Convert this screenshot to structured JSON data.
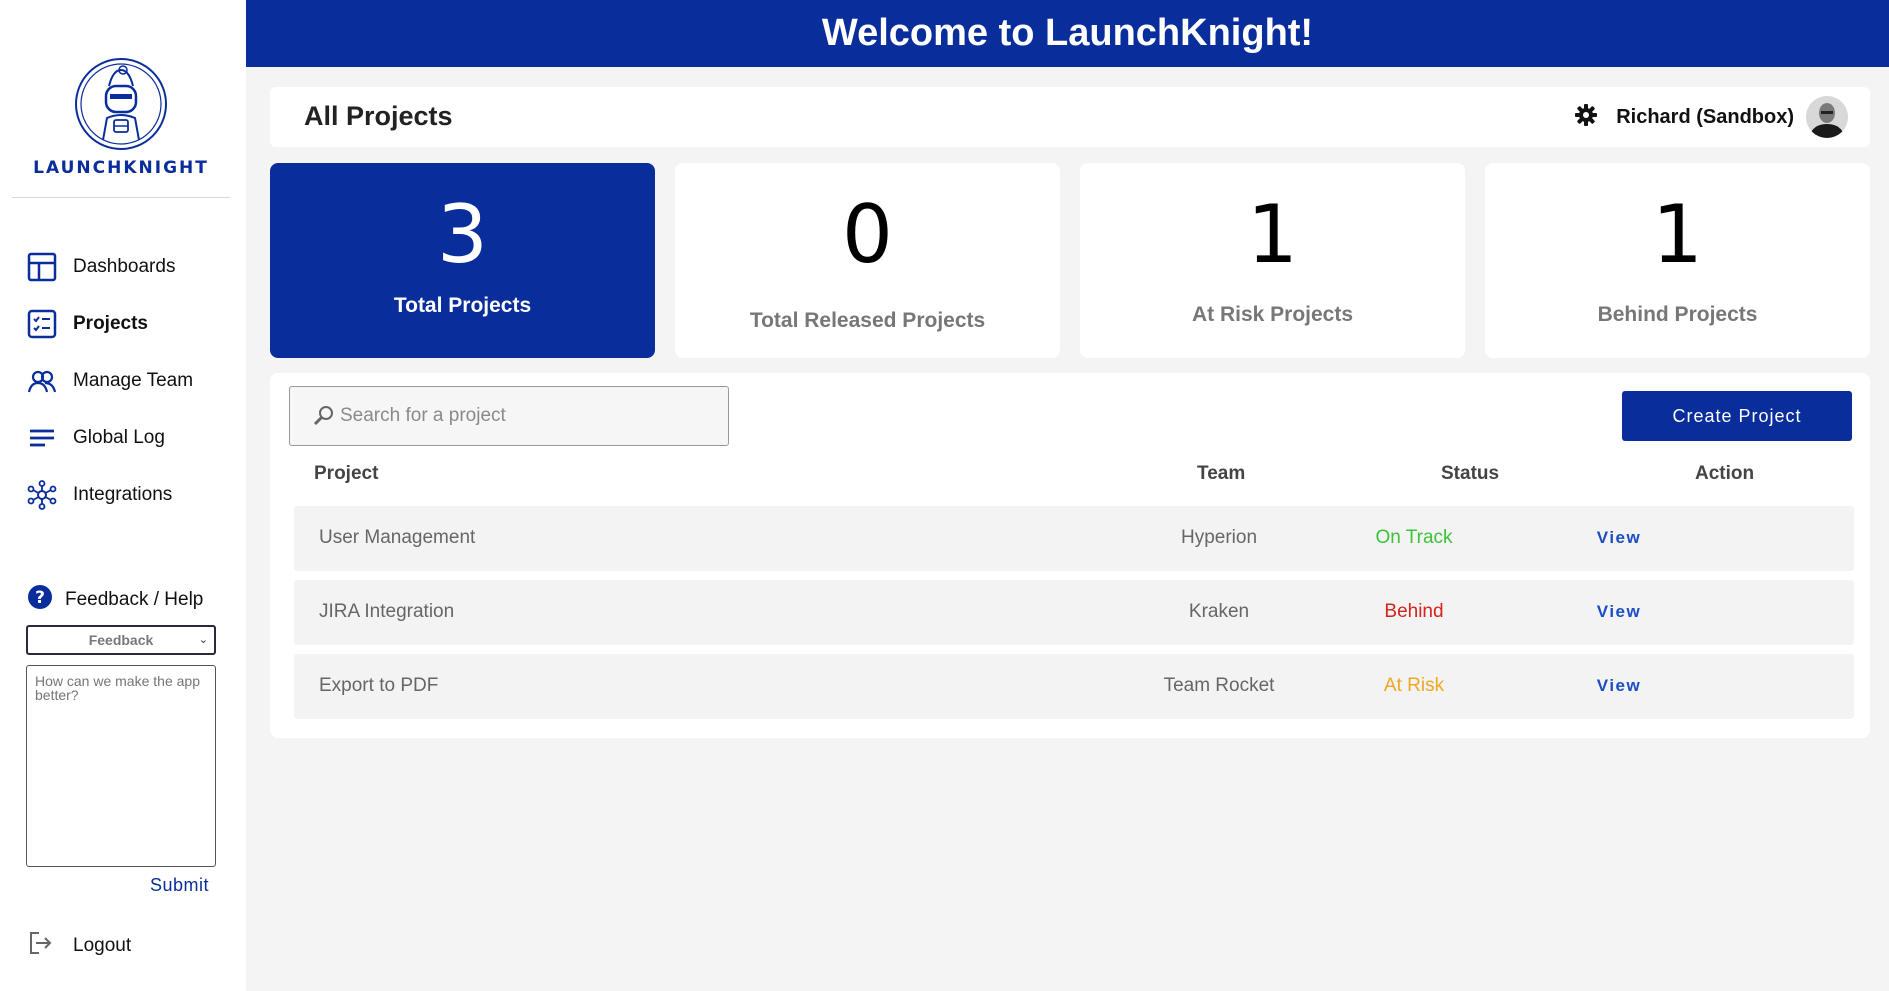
{
  "brand": {
    "logo_text": "LAUNCHKNIGHT",
    "primary_color": "#0a2d9c",
    "banner_title": "Welcome to LaunchKnight!"
  },
  "sidebar": {
    "items": [
      {
        "label": "Dashboards",
        "icon": "dashboard-icon"
      },
      {
        "label": "Projects",
        "icon": "checklist-icon",
        "active": true
      },
      {
        "label": "Manage Team",
        "icon": "team-icon"
      },
      {
        "label": "Global Log",
        "icon": "log-lines-icon"
      },
      {
        "label": "Integrations",
        "icon": "integrations-network-icon"
      }
    ],
    "help_label": "Feedback / Help",
    "feedback_select_value": "Feedback",
    "feedback_placeholder": "How can we make the app better?",
    "submit_label": "Submit",
    "logout_label": "Logout"
  },
  "header": {
    "title": "All Projects",
    "user_name": "Richard (Sandbox)"
  },
  "stats": [
    {
      "value": "3",
      "label": "Total Projects"
    },
    {
      "value": "0",
      "label": "Total Released Projects"
    },
    {
      "value": "1",
      "label": "At Risk Projects"
    },
    {
      "value": "1",
      "label": "Behind Projects"
    }
  ],
  "projects": {
    "search_placeholder": "Search for a project",
    "create_label": "Create Project",
    "columns": [
      "Project",
      "Team",
      "Status",
      "Action"
    ],
    "rows": [
      {
        "project": "User Management",
        "team": "Hyperion",
        "status": "On Track",
        "status_color": "#3cc33c",
        "action": "View"
      },
      {
        "project": "JIRA Integration",
        "team": "Kraken",
        "status": "Behind",
        "status_color": "#d3231b",
        "action": "View"
      },
      {
        "project": "Export to PDF",
        "team": "Team Rocket",
        "status": "At Risk",
        "status_color": "#f0a820",
        "action": "View"
      }
    ]
  }
}
